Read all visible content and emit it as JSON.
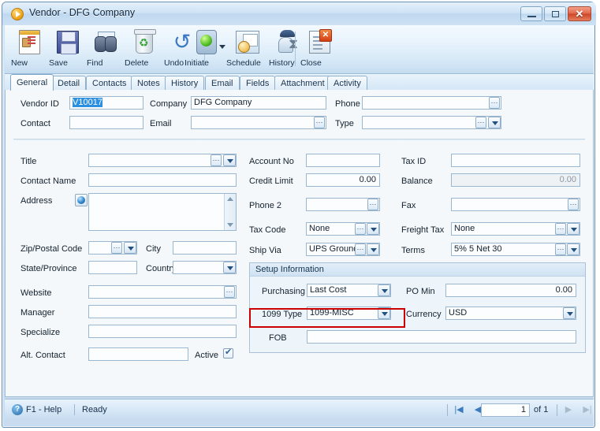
{
  "window": {
    "title": "Vendor - DFG Company",
    "app_icon": "play-circle-icon",
    "minimize_label": "minimize-icon",
    "maximize_label": "maximize-icon",
    "close_label": "✕"
  },
  "toolbar": {
    "buttons": [
      {
        "label": "New",
        "icon": "new-record-icon"
      },
      {
        "label": "Save",
        "icon": "floppy-disk-icon"
      },
      {
        "label": "Find",
        "icon": "binoculars-icon"
      },
      {
        "label": "Delete",
        "icon": "recycle-bin-icon"
      },
      {
        "label": "Undo",
        "icon": "undo-arrow-icon"
      },
      {
        "label": "Initiate",
        "icon": "traffic-light-icon"
      },
      {
        "label": "Schedule",
        "icon": "calendar-clock-icon"
      },
      {
        "label": "History",
        "icon": "person-hourglass-icon"
      },
      {
        "label": "Close",
        "icon": "document-close-icon"
      }
    ]
  },
  "tabs": [
    {
      "label": "General",
      "active": true
    },
    {
      "label": "Detail",
      "active": false
    },
    {
      "label": "Contacts",
      "active": false
    },
    {
      "label": "Notes",
      "active": false
    },
    {
      "label": "History",
      "active": false
    },
    {
      "label": "Email",
      "active": false
    },
    {
      "label": "Fields",
      "active": false
    },
    {
      "label": "Attachment",
      "active": false
    },
    {
      "label": "Activity",
      "active": false
    }
  ],
  "header": {
    "vendor_id_label": "Vendor ID",
    "vendor_id_value": "V10017",
    "contact_label": "Contact",
    "contact_value": "",
    "company_label": "Company",
    "company_value": "DFG Company",
    "email_label": "Email",
    "email_value": "",
    "phone_label": "Phone",
    "phone_value": "",
    "type_label": "Type",
    "type_value": ""
  },
  "left_column": {
    "title_label": "Title",
    "title_value": "",
    "contact_name_label": "Contact Name",
    "contact_name_value": "",
    "address_label": "Address",
    "address_value": "",
    "zip_label": "Zip/Postal Code",
    "zip_value": "",
    "city_label": "City",
    "city_value": "",
    "state_label": "State/Province",
    "state_value": "",
    "country_label": "Country",
    "country_value": "",
    "website_label": "Website",
    "website_value": "",
    "manager_label": "Manager",
    "manager_value": "",
    "specialize_label": "Specialize",
    "specialize_value": "",
    "alt_contact_label": "Alt. Contact",
    "alt_contact_value": "",
    "active_label": "Active",
    "active_checked": true
  },
  "middle_column": {
    "account_no_label": "Account No",
    "account_no_value": "",
    "credit_limit_label": "Credit Limit",
    "credit_limit_value": "0.00",
    "phone2_label": "Phone 2",
    "phone2_value": "",
    "tax_code_label": "Tax Code",
    "tax_code_value": "None",
    "ship_via_label": "Ship Via",
    "ship_via_value": "UPS Ground"
  },
  "right_column": {
    "tax_id_label": "Tax ID",
    "tax_id_value": "",
    "balance_label": "Balance",
    "balance_value": "0.00",
    "fax_label": "Fax",
    "fax_value": "",
    "freight_tax_label": "Freight Tax",
    "freight_tax_value": "None",
    "terms_label": "Terms",
    "terms_value": "5% 5 Net 30"
  },
  "setup_information": {
    "group_title": "Setup Information",
    "purchasing_label": "Purchasing",
    "purchasing_value": "Last Cost",
    "po_min_label": "PO Min",
    "po_min_value": "0.00",
    "type1099_label": "1099 Type",
    "type1099_value": "1099-MISC",
    "currency_label": "Currency",
    "currency_value": "USD",
    "fob_label": "FOB",
    "fob_value": "",
    "highlight_color": "#cc0000"
  },
  "statusbar": {
    "help_icon": "question-mark-icon",
    "help_text": "F1 - Help",
    "ready_text": "Ready",
    "first_icon": "|◀",
    "prev_icon": "◀",
    "record_number": "1",
    "of_text": "of 1",
    "next_icon": "▶",
    "last_icon": "▶|"
  },
  "colors": {
    "accent": "#2d8fe0",
    "highlight": "#cc0000",
    "frame": "#6a91b5"
  }
}
